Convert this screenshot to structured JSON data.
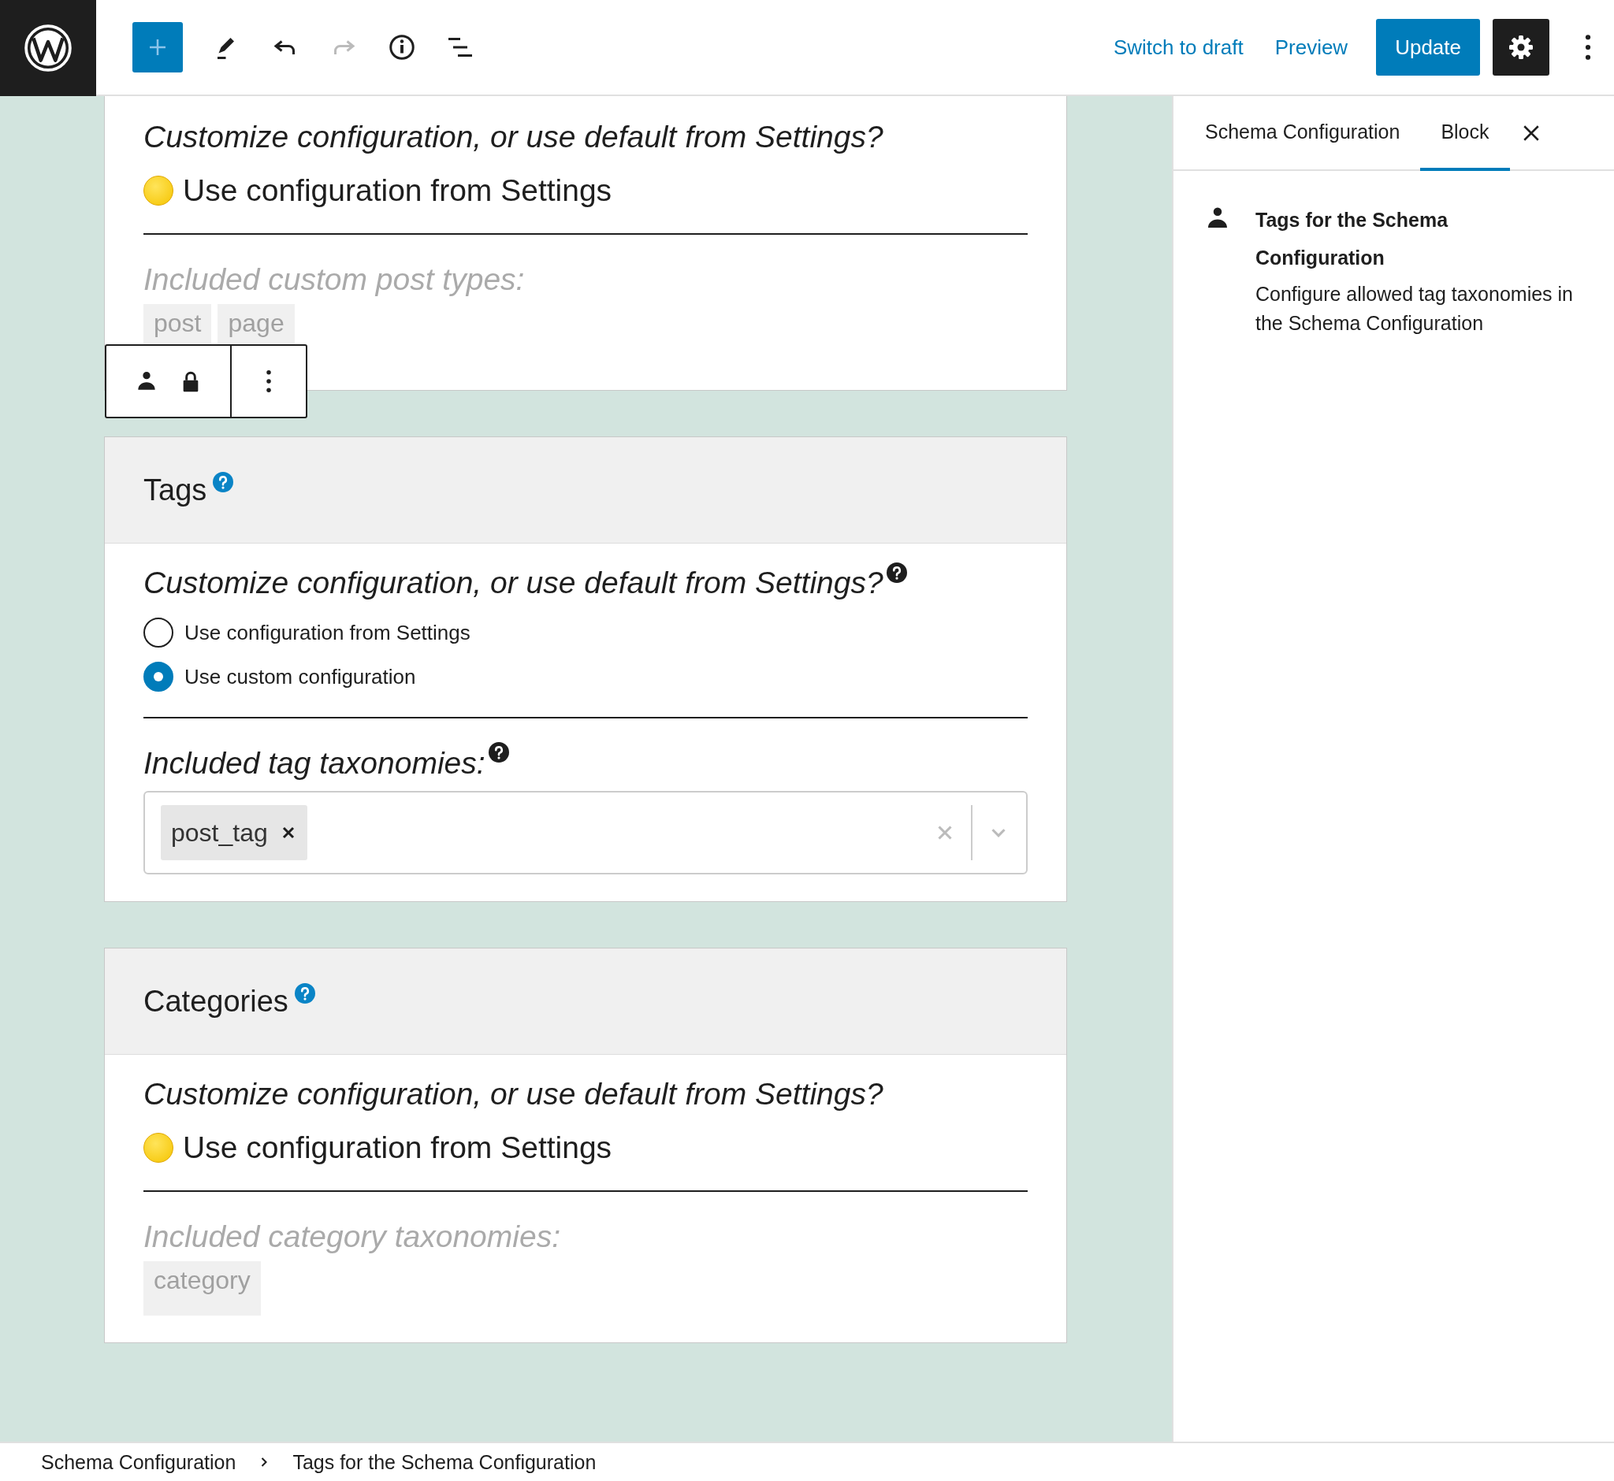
{
  "header": {
    "tools": [
      {
        "kind": "inserter",
        "disabled": false
      },
      {
        "kind": "edit",
        "disabled": false
      },
      {
        "kind": "undo",
        "disabled": false
      },
      {
        "kind": "redo",
        "disabled": true
      },
      {
        "kind": "info",
        "disabled": false
      },
      {
        "kind": "list",
        "disabled": false
      }
    ],
    "links": [
      "Switch to draft",
      "Preview"
    ],
    "primary": "Update"
  },
  "cards": [
    {
      "kind": "summary",
      "question": "Customize configuration, or use default from Settings?",
      "choice": "Use configuration from Settings",
      "field_label": "Included custom post types:",
      "values": [
        "post",
        "page"
      ]
    },
    {
      "kind": "editable",
      "title": "Tags",
      "question": "Customize configuration, or use default from Settings?",
      "options": [
        {
          "label": "Use configuration from Settings",
          "selected": false
        },
        {
          "label": "Use custom configuration",
          "selected": true
        }
      ],
      "field_label": "Included tag taxonomies:",
      "values": [
        "post_tag"
      ]
    },
    {
      "kind": "summary",
      "title": "Categories",
      "question": "Customize configuration, or use default from Settings?",
      "choice": "Use configuration from Settings",
      "field_label": "Included category taxonomies:",
      "values": [
        "category"
      ]
    }
  ],
  "sidebar": {
    "tabs": [
      {
        "label": "Schema Configuration",
        "selected": false
      },
      {
        "label": "Block",
        "selected": true
      }
    ],
    "block_title": "Tags for the Schema Configuration",
    "block_description": "Configure allowed tag taxonomies in the Schema Configuration"
  },
  "breadcrumb": [
    "Schema Configuration",
    "Tags for the Schema Configuration"
  ]
}
